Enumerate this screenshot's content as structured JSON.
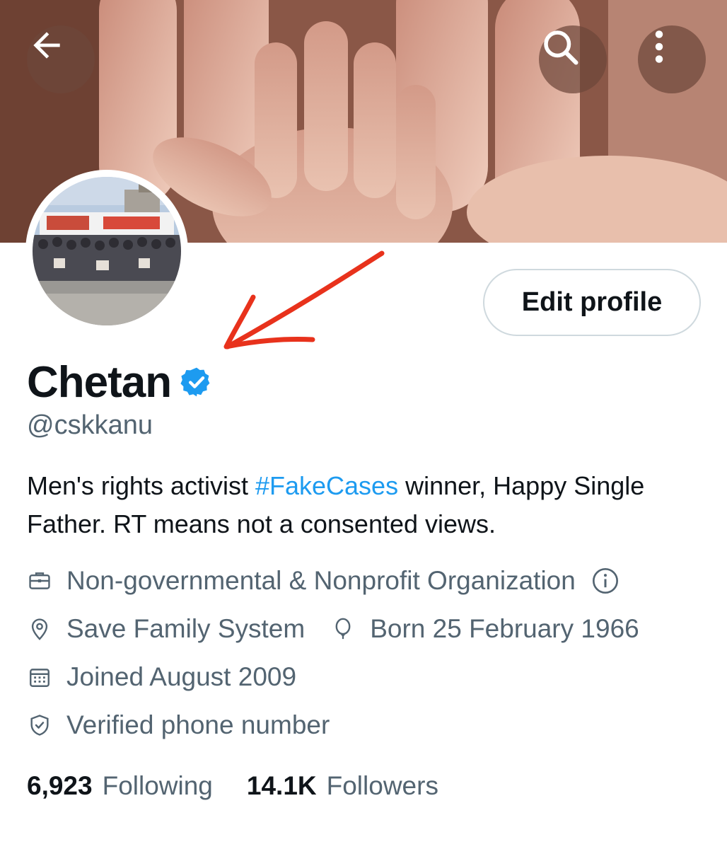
{
  "header": {
    "back_icon": "arrow-left-icon",
    "search_icon": "search-icon",
    "more_icon": "more-vertical-icon"
  },
  "profile": {
    "name": "Chetan",
    "verified_icon": "verified-badge-icon",
    "handle": "@cskkanu",
    "edit_button": "Edit profile",
    "bio": {
      "part1": "Men's rights activist  ",
      "hashtag": "#FakeCases",
      "part2": " winner, Happy Single Father. RT means not a consented views."
    },
    "category": "Non-governmental & Nonprofit Organization",
    "location": "Save Family System",
    "birthday": "Born 25 February 1966",
    "joined": "Joined August 2009",
    "verified_phone": "Verified phone number"
  },
  "stats": {
    "following_count": "6,923",
    "following_label": "Following",
    "followers_count": "14.1K",
    "followers_label": "Followers"
  },
  "colors": {
    "text": "#0f1419",
    "secondary": "#536471",
    "accent": "#1d9bf0",
    "annotation": "#e8321c"
  }
}
